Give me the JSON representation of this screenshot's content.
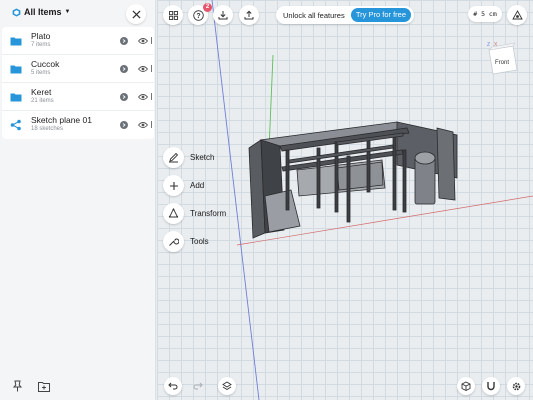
{
  "sidebar": {
    "title": "All Items",
    "items": [
      {
        "name": "Plato",
        "sub": "7 items",
        "icon": "folder-icon"
      },
      {
        "name": "Cuccok",
        "sub": "5 items",
        "icon": "folder-icon"
      },
      {
        "name": "Keret",
        "sub": "21 items",
        "icon": "folder-icon"
      },
      {
        "name": "Sketch plane 01",
        "sub": "18 sketches",
        "icon": "share-nodes-icon"
      }
    ]
  },
  "toolbar": {
    "badge_count": "2",
    "unlock_label": "Unlock all features",
    "pro_label": "Try Pro for free",
    "grid_size": "# 5 cm"
  },
  "view_cube": {
    "face_label": "Front",
    "axis_z": "Z",
    "axis_x": "X"
  },
  "tools": [
    {
      "label": "Sketch"
    },
    {
      "label": "Add"
    },
    {
      "label": "Transform"
    },
    {
      "label": "Tools"
    }
  ],
  "colors": {
    "accent": "#2795d9",
    "badge": "#e4566b",
    "folder": "#2795d9",
    "model_dark": "#4a4d52"
  }
}
